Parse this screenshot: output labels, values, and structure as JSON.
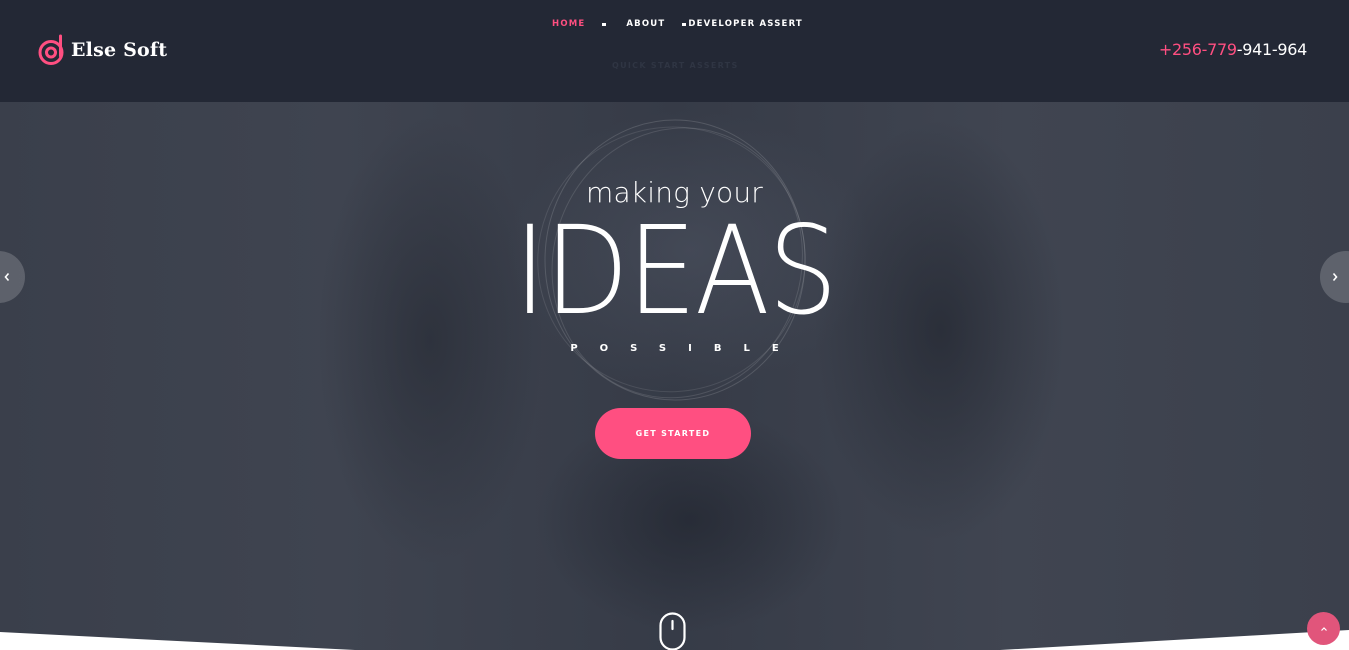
{
  "brand": {
    "name": "Else Soft",
    "accent_color": "#ff4f81"
  },
  "header": {
    "nav": [
      {
        "label": "HOME",
        "active": true
      },
      {
        "label": "ABOUT",
        "active": false
      },
      {
        "label": "DEVELOPER ASSERT",
        "active": false
      }
    ],
    "submenu_label": "QUICK START ASSERTS",
    "phone": {
      "accent": "+256-779",
      "rest": "-941-964"
    }
  },
  "hero": {
    "line1": "making your",
    "headline": "IDEAS",
    "line3": "POSSIBLE",
    "cta_label": "GET STARTED"
  },
  "icons": {
    "logo": "logo-mark-icon",
    "prev": "chevron-left-icon",
    "next": "chevron-right-icon",
    "scroll": "mouse-scroll-icon",
    "back_to_top": "chevron-up-icon"
  }
}
